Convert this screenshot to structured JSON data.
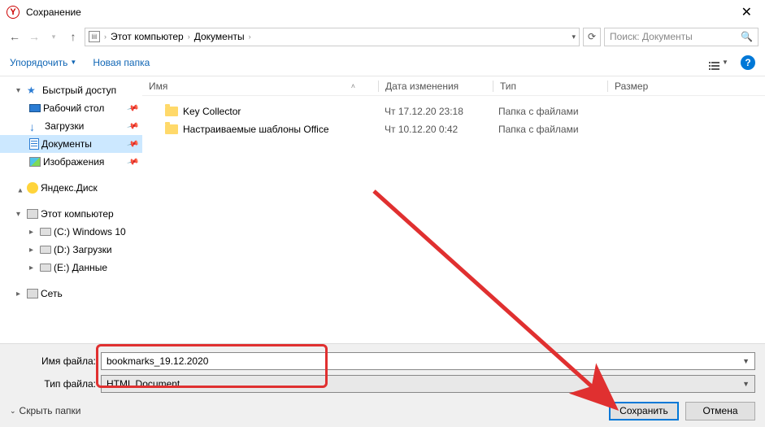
{
  "title": "Сохранение",
  "nav": {
    "crumbs": [
      "Этот компьютер",
      "Документы"
    ],
    "search_placeholder": "Поиск: Документы"
  },
  "toolbar": {
    "organize": "Упорядочить",
    "new_folder": "Новая папка"
  },
  "sidebar": {
    "quick_access": "Быстрый доступ",
    "desktop": "Рабочий стол",
    "downloads": "Загрузки",
    "documents": "Документы",
    "pictures": "Изображения",
    "yandex_disk": "Яндекс.Диск",
    "this_pc": "Этот компьютер",
    "drives": [
      "(C:) Windows 10",
      "(D:) Загрузки",
      "(E:) Данные"
    ],
    "network": "Сеть"
  },
  "columns": {
    "name": "Имя",
    "date": "Дата изменения",
    "type": "Тип",
    "size": "Размер"
  },
  "rows": [
    {
      "name": "Key Collector",
      "date": "Чт 17.12.20 23:18",
      "type": "Папка с файлами"
    },
    {
      "name": "Настраиваемые шаблоны Office",
      "date": "Чт 10.12.20 0:42",
      "type": "Папка с файлами"
    }
  ],
  "fields": {
    "name_label": "Имя файла:",
    "name_value": "bookmarks_19.12.2020",
    "type_label": "Тип файла:",
    "type_value": "HTML Document"
  },
  "footer": {
    "hide": "Скрыть папки",
    "save": "Сохранить",
    "cancel": "Отмена"
  }
}
